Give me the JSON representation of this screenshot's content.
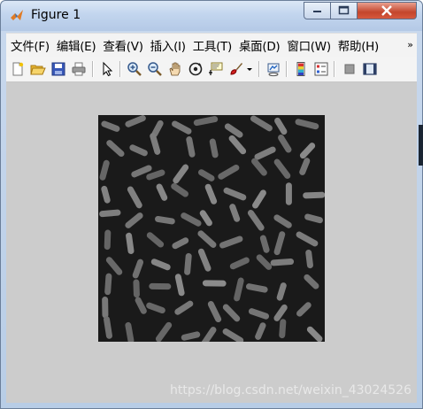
{
  "window": {
    "title": "Figure 1",
    "controls": {
      "minimize": "minimize",
      "maximize": "maximize",
      "close": "close"
    }
  },
  "menubar": {
    "items": [
      {
        "label": "文件(F)"
      },
      {
        "label": "编辑(E)"
      },
      {
        "label": "查看(V)"
      },
      {
        "label": "插入(I)"
      },
      {
        "label": "工具(T)"
      },
      {
        "label": "桌面(D)"
      },
      {
        "label": "窗口(W)"
      },
      {
        "label": "帮助(H)"
      }
    ],
    "overflow": "»"
  },
  "toolbar": {
    "tools": [
      "new-figure-icon",
      "open-file-icon",
      "save-icon",
      "print-icon",
      "select-arrow-icon",
      "zoom-in-icon",
      "zoom-out-icon",
      "pan-hand-icon",
      "rotate-3d-icon",
      "data-cursor-icon",
      "brush-icon",
      "link-plot-icon",
      "colorbar-icon",
      "legend-icon",
      "hide-plot-tools-icon",
      "show-plot-tools-icon"
    ]
  },
  "figure": {
    "image_description_colors": {
      "background": "#1a1a1a",
      "grain": "#7a7a7a"
    }
  },
  "watermark": "https://blog.csdn.net/weixin_43024526"
}
